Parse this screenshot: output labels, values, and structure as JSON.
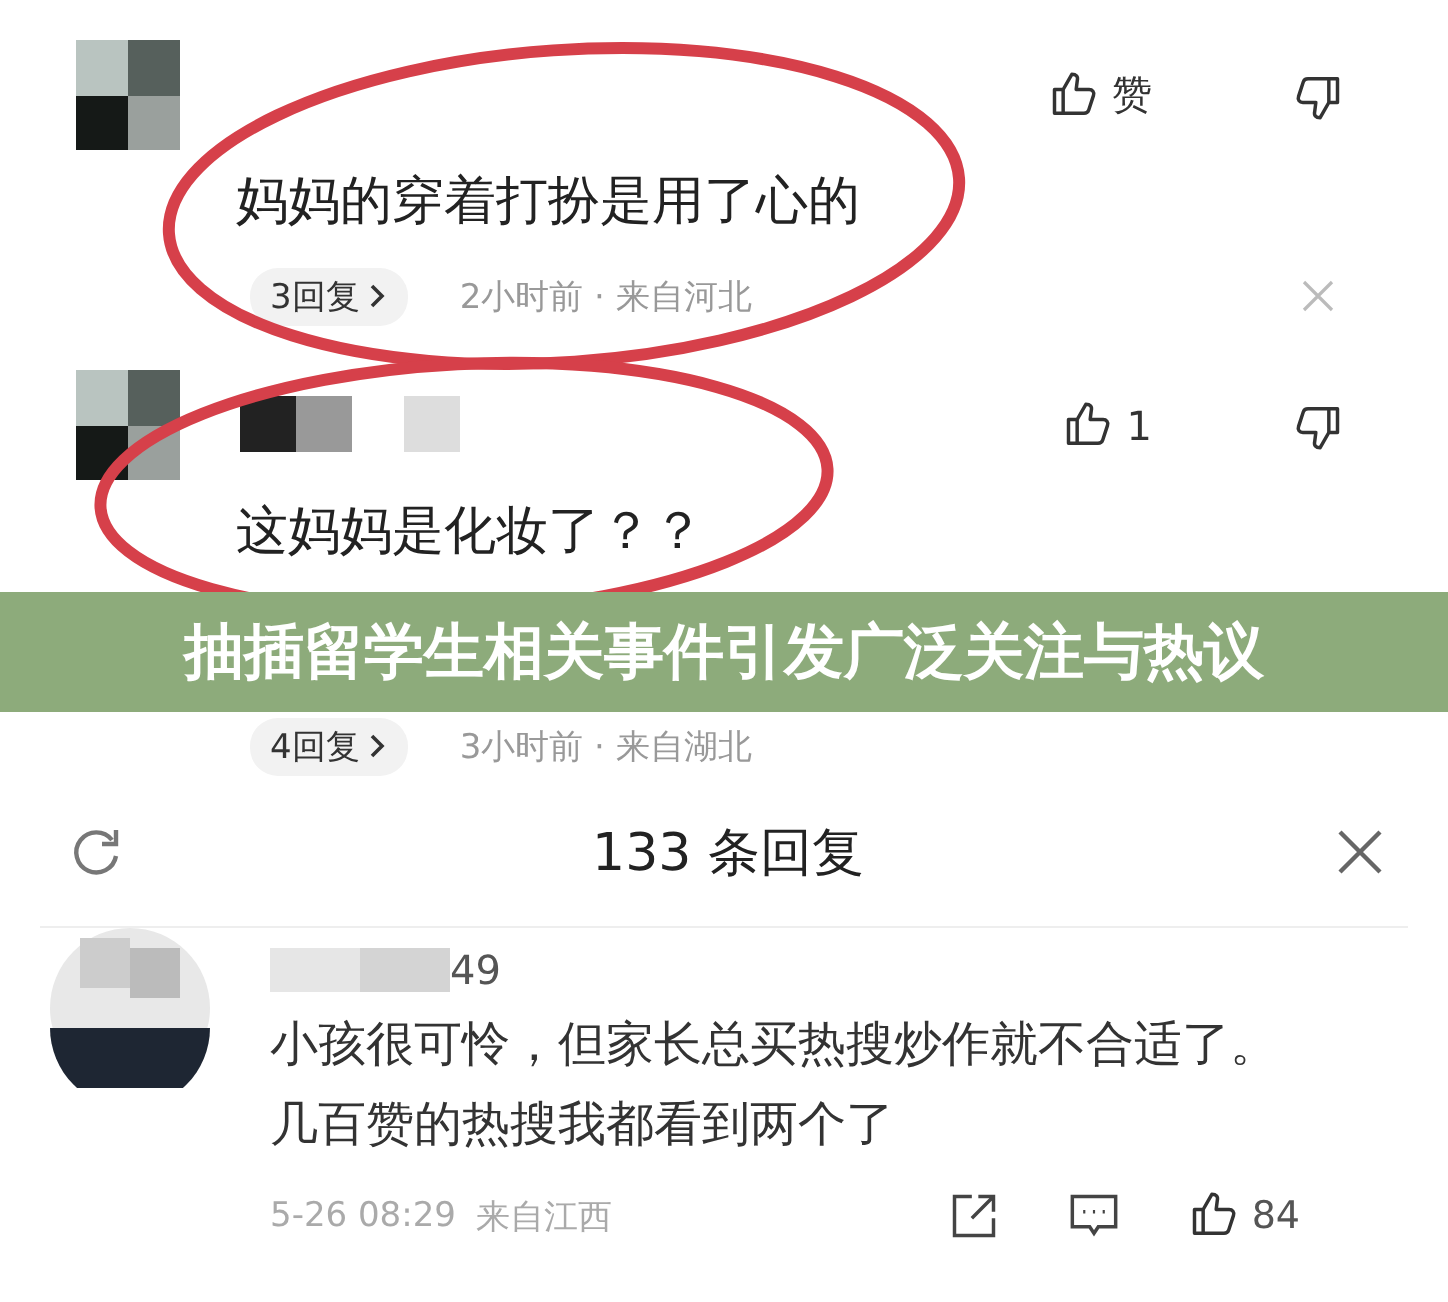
{
  "comments": [
    {
      "text": "妈妈的穿着打扮是用了心的",
      "like_label": "赞",
      "replies": "3回复",
      "meta": "2小时前 · 来自河北",
      "show_close": true,
      "name_hidden": false,
      "highlighted": true
    },
    {
      "text": "这妈妈是化妆了？？",
      "like_label": "1",
      "replies": "4回复",
      "meta": "3小时前 · 来自湖北",
      "show_close": false,
      "name_hidden": true,
      "highlighted": true
    }
  ],
  "banner": {
    "title": "抽插留学生相关事件引发广泛关注与热议"
  },
  "reply_panel": {
    "title": "133 条回复",
    "replies": [
      {
        "username": "49",
        "text": "小孩很可怜，但家长总买热搜炒作就不合适了。几百赞的热搜我都看到两个了",
        "time": "5-26 08:29",
        "location": "来自江西",
        "likes": "84"
      }
    ]
  }
}
